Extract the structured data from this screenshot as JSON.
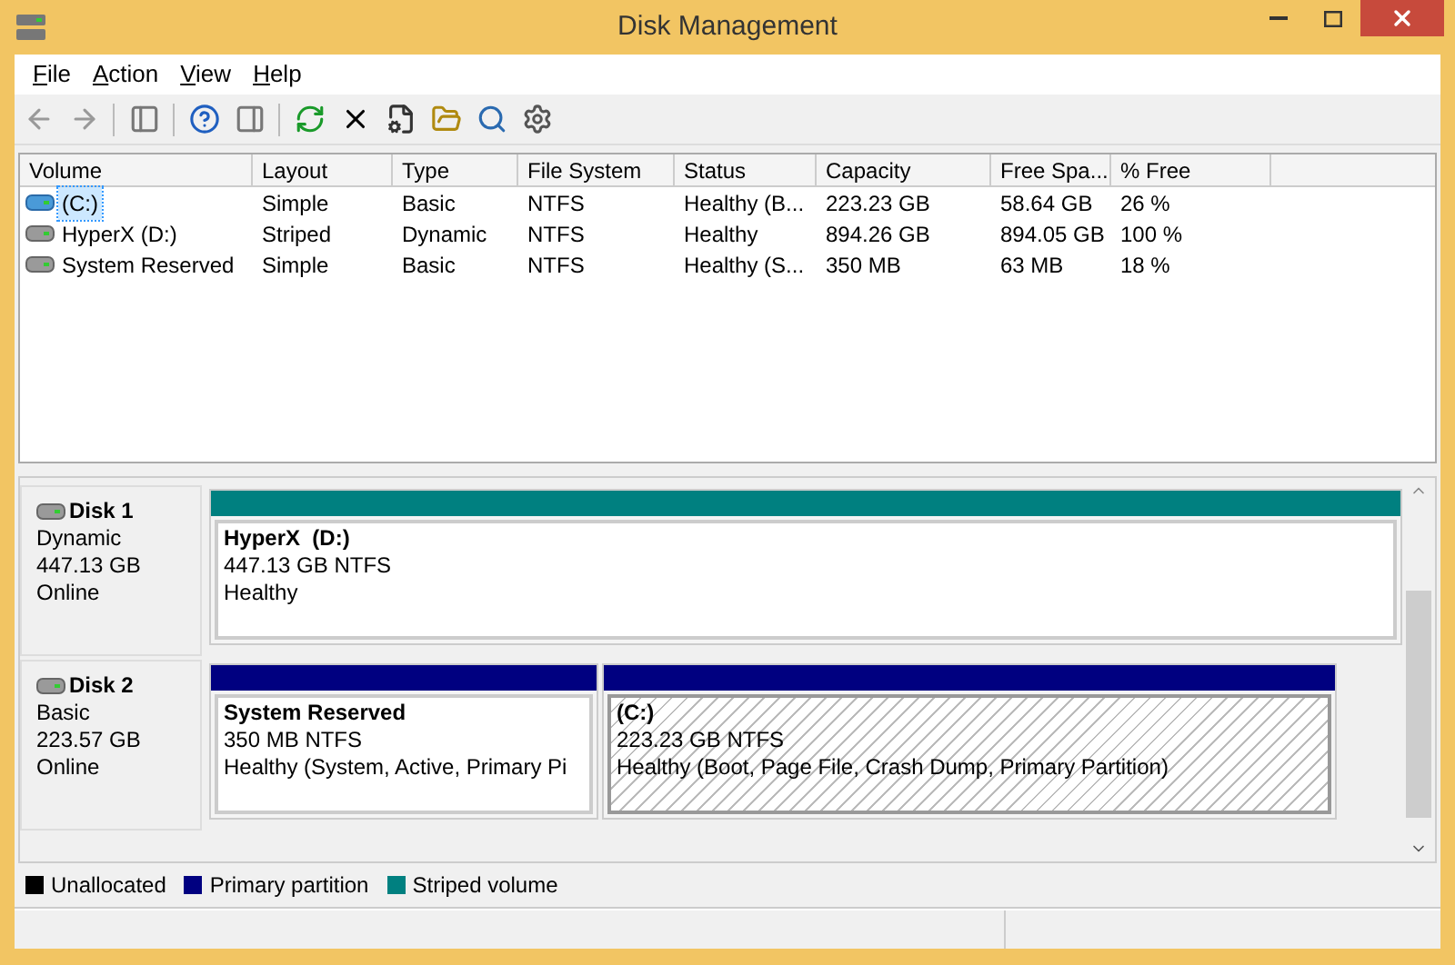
{
  "window": {
    "title": "Disk Management"
  },
  "menu": [
    "File",
    "Action",
    "View",
    "Help"
  ],
  "volumes": {
    "columns": [
      "Volume",
      "Layout",
      "Type",
      "File System",
      "Status",
      "Capacity",
      "Free Spa...",
      "% Free"
    ],
    "rows": [
      {
        "selected": true,
        "cells": [
          "(C:)",
          "Simple",
          "Basic",
          "NTFS",
          "Healthy (B...",
          "223.23 GB",
          "58.64 GB",
          "26 %"
        ]
      },
      {
        "selected": false,
        "cells": [
          "HyperX (D:)",
          "Striped",
          "Dynamic",
          "NTFS",
          "Healthy",
          "894.26 GB",
          "894.05 GB",
          "100 %"
        ]
      },
      {
        "selected": false,
        "cells": [
          "System Reserved",
          "Simple",
          "Basic",
          "NTFS",
          "Healthy (S...",
          "350 MB",
          "63 MB",
          "18 %"
        ]
      }
    ]
  },
  "disks": [
    {
      "name": "Disk 1",
      "type": "Dynamic",
      "size": "447.13 GB",
      "status": "Online",
      "partitions": [
        {
          "kind": "striped",
          "selected": false,
          "label": "HyperX  (D:)",
          "size": "447.13 GB NTFS",
          "status": "Healthy"
        }
      ]
    },
    {
      "name": "Disk 2",
      "type": "Basic",
      "size": "223.57 GB",
      "status": "Online",
      "partitions": [
        {
          "kind": "primary",
          "selected": false,
          "label": "System Reserved",
          "size": "350 MB NTFS",
          "status": "Healthy (System, Active, Primary Pi"
        },
        {
          "kind": "primary",
          "selected": true,
          "label": "(C:)",
          "size": "223.23 GB NTFS",
          "status": "Healthy (Boot, Page File, Crash Dump, Primary Partition)"
        }
      ]
    }
  ],
  "legend": [
    {
      "label": "Unallocated",
      "color": "#000000"
    },
    {
      "label": "Primary partition",
      "color": "#000080"
    },
    {
      "label": "Striped volume",
      "color": "#008080"
    }
  ]
}
